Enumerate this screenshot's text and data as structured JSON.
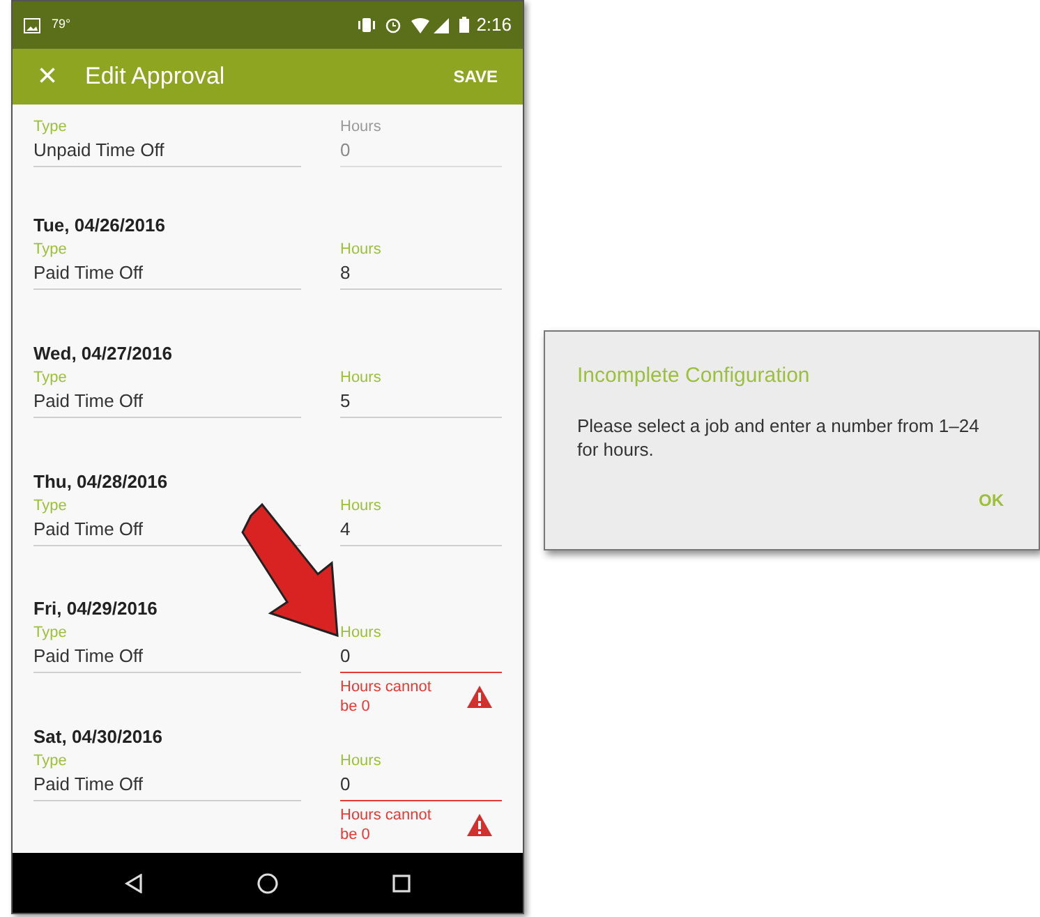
{
  "status_bar": {
    "temperature": "79°",
    "time": "2:16"
  },
  "app_bar": {
    "close": "×",
    "title": "Edit Approval",
    "action": "SAVE"
  },
  "entries": [
    {
      "type_label": "Type",
      "type_value": "Unpaid Time Off",
      "hours_label": "Hours",
      "hours_value": "0",
      "disabled": true
    },
    {
      "date": "Tue, 04/26/2016",
      "type_label": "Type",
      "type_value": "Paid Time Off",
      "hours_label": "Hours",
      "hours_value": "8",
      "disabled": false
    },
    {
      "date": "Wed, 04/27/2016",
      "type_label": "Type",
      "type_value": "Paid Time Off",
      "hours_label": "Hours",
      "hours_value": "5",
      "disabled": false
    },
    {
      "date": "Thu, 04/28/2016",
      "type_label": "Type",
      "type_value": "Paid Time Off",
      "hours_label": "Hours",
      "hours_value": "4",
      "disabled": false
    },
    {
      "date": "Fri, 04/29/2016",
      "type_label": "Type",
      "type_value": "Paid Time Off",
      "hours_label": "Hours",
      "hours_value": "0",
      "disabled": false,
      "error": "Hours cannot be 0"
    },
    {
      "date": "Sat, 04/30/2016",
      "type_label": "Type",
      "type_value": "Paid Time Off",
      "hours_label": "Hours",
      "hours_value": "0",
      "disabled": false,
      "error": "Hours cannot be 0"
    }
  ],
  "dialog": {
    "title": "Incomplete Configuration",
    "message": "Please select a job and enter a number from 1–24 for hours.",
    "button": "OK"
  }
}
